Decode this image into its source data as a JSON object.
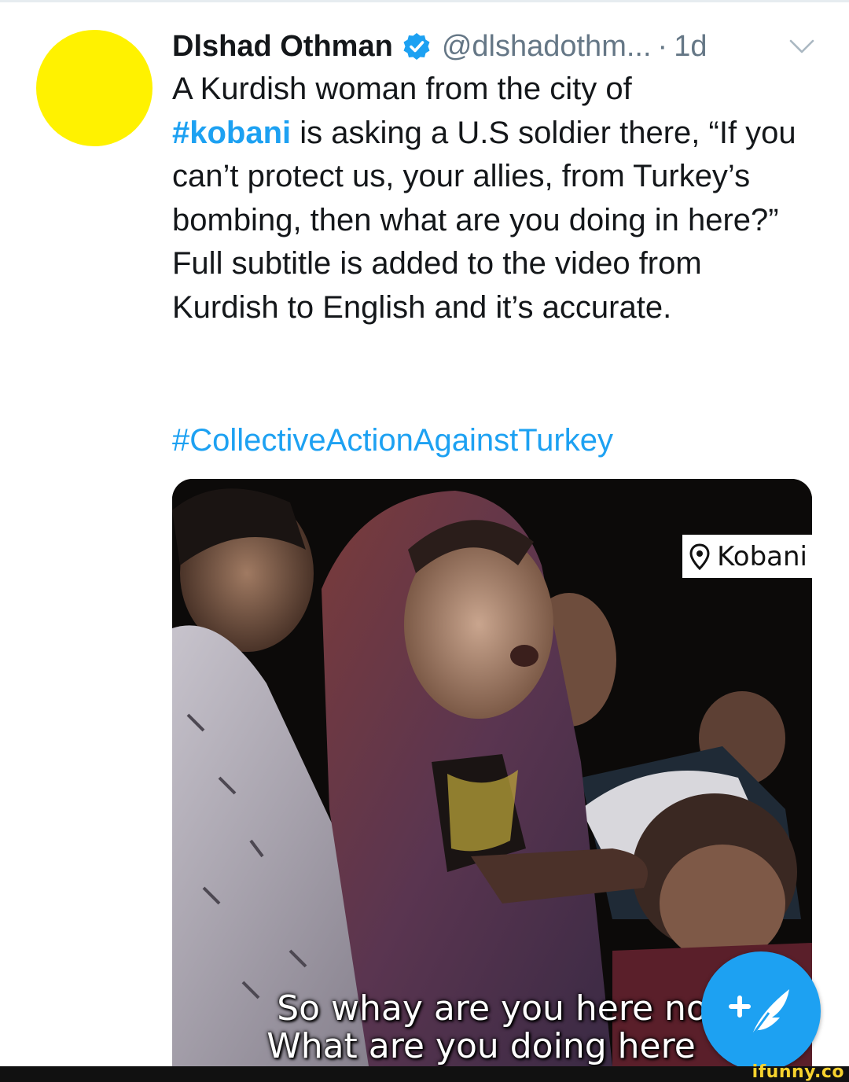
{
  "tweet": {
    "display_name": "Dlshad Othman",
    "handle": "@dlshadothm...",
    "separator": "·",
    "timestamp": "1d",
    "body_line_1": "A Kurdish woman from the city of",
    "inline_hashtag": "#kobani",
    "body_line_2_rest": " is asking a U.S soldier there, “If you can’t protect us, your allies, from Turkey’s bombing, then what are you doing in here?”",
    "body_paragraph_2": "Full subtitle is added to the video from Kurdish to English and it’s accurate.",
    "hashtag": "#CollectiveActionAgainstTurkey"
  },
  "media": {
    "location_label": "Kobani",
    "subtitle_line_1": "So whay are you here no",
    "subtitle_line_2": "What are you doing here"
  },
  "watermark": "ifunny.co",
  "icons": {
    "verified": "verified-badge-icon",
    "caret": "chevron-down-icon",
    "location": "location-pin-icon",
    "compose": "compose-tweet-icon"
  },
  "colors": {
    "link_blue": "#1da1f2",
    "secondary_gray": "#657786",
    "avatar_yellow": "#fff200",
    "watermark_yellow": "#f7d22e"
  }
}
